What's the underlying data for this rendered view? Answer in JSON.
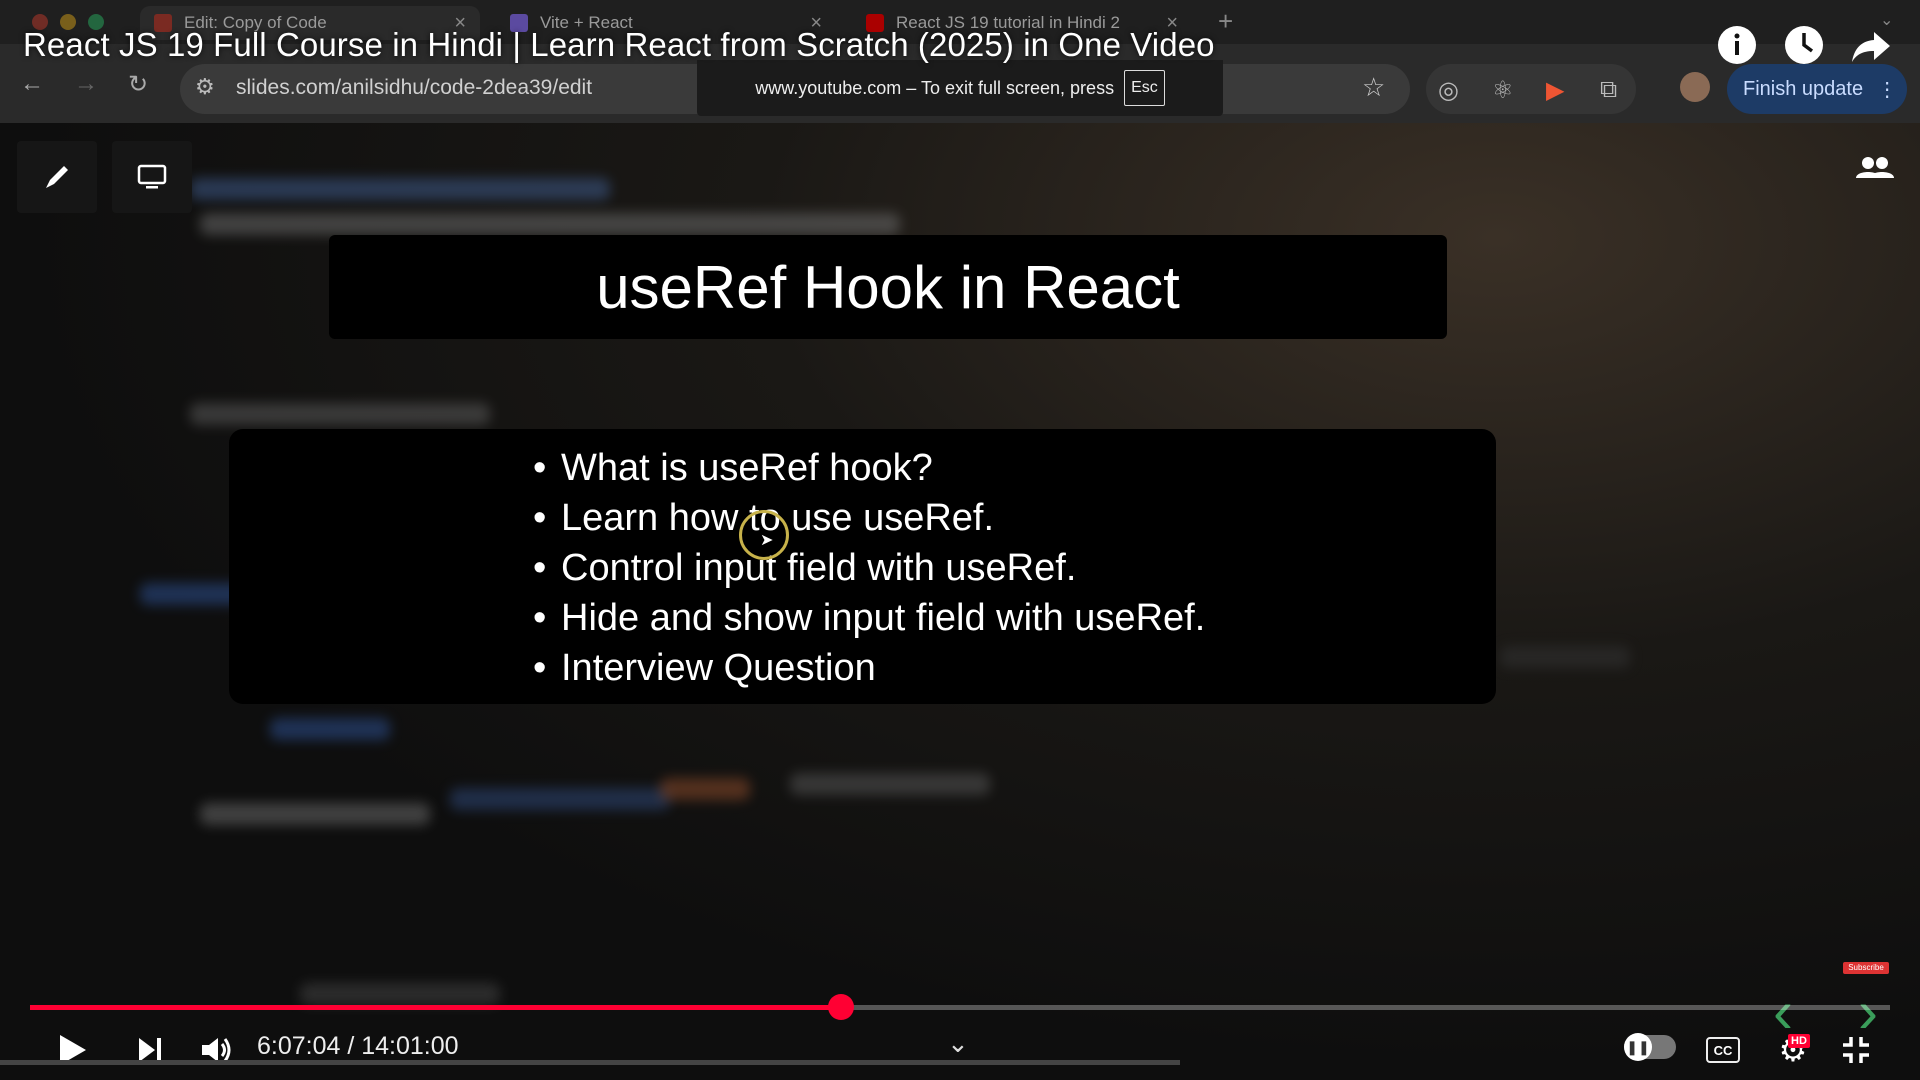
{
  "browser": {
    "tabs": [
      {
        "label": "Edit: Copy of Code",
        "favicon_color": "#c0392b"
      },
      {
        "label": "Vite + React",
        "favicon_color": "#8a6cff"
      },
      {
        "label": "React JS 19 tutorial in Hindi 2",
        "favicon_color": "#ff0000"
      }
    ],
    "new_tab_symbol": "+",
    "url": "slides.com/anilsidhu/code-2dea39/edit",
    "fullscreen_notice": "www.youtube.com – To exit full screen, press",
    "fullscreen_key": "Esc",
    "finish_update_label": "Finish update"
  },
  "video": {
    "title": "React JS 19 Full Course in Hindi | Learn React from Scratch (2025) in One Video",
    "current_time": "6:07:04",
    "duration": "14:01:00",
    "time_display": "6:07:04 / 14:01:00",
    "progress_percent": 43.6,
    "accent_color": "#ff0033"
  },
  "slide": {
    "title": "useRef Hook in React",
    "bullets": [
      "What is useRef hook?",
      "Learn how to use useRef.",
      "Control input field with useRef.",
      "Hide and show input field with useRef.",
      "Interview Question"
    ]
  },
  "controls": {
    "cc_label": "CC",
    "hd_label": "HD",
    "subscribe_label": "Subscribe"
  },
  "icons": [
    "pen-icon",
    "monitor-icon",
    "people-icon",
    "info-icon",
    "clock-icon",
    "share-icon",
    "play-icon",
    "next-icon",
    "volume-icon",
    "settings-icon",
    "exit-fullscreen-icon"
  ]
}
